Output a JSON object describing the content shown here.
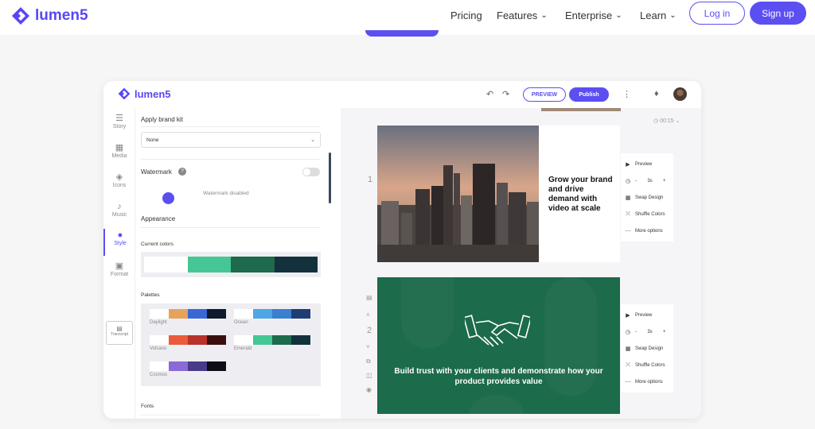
{
  "site": {
    "brand": "lumen5",
    "nav": [
      "Pricing",
      "Features",
      "Enterprise",
      "Learn"
    ],
    "login": "Log in",
    "signup": "Sign up",
    "brand_color": "#5b4ff2"
  },
  "app": {
    "brand": "lumen5",
    "preview": "PREVIEW",
    "publish": "Publish",
    "rail": [
      {
        "label": "Story",
        "icon": "story-icon"
      },
      {
        "label": "Media",
        "icon": "image-icon"
      },
      {
        "label": "Icons",
        "icon": "shapes-icon"
      },
      {
        "label": "Music",
        "icon": "music-icon"
      },
      {
        "label": "Style",
        "icon": "palette-icon"
      },
      {
        "label": "Format",
        "icon": "format-icon"
      },
      {
        "label": "Transcript",
        "icon": "transcript-icon"
      }
    ],
    "panel": {
      "brand_kit_label": "Apply brand kit",
      "brand_kit_value": "None",
      "watermark_label": "Watermark",
      "watermark_status": "Watermark disabled",
      "appearance": "Appearance",
      "current_colors_label": "Current colors",
      "current_colors": [
        "#ffffff",
        "#45c795",
        "#1d6a4d",
        "#13313d"
      ],
      "palettes_label": "Palettes",
      "palettes": [
        {
          "name": "Daylight",
          "colors": [
            "#ffffff",
            "#e8a35b",
            "#3a67d6",
            "#0d1a2f"
          ]
        },
        {
          "name": "Ocean",
          "colors": [
            "#ffffff",
            "#4fa6e3",
            "#3b7fd1",
            "#1e3d73"
          ]
        },
        {
          "name": "Volcano",
          "colors": [
            "#ffffff",
            "#ea5a3c",
            "#b8312a",
            "#3b0f0f"
          ]
        },
        {
          "name": "Emerald",
          "colors": [
            "#ffffff",
            "#45c795",
            "#1d6a4d",
            "#13313d"
          ]
        },
        {
          "name": "Cosmos",
          "colors": [
            "#ffffff",
            "#8a6ad6",
            "#4a3a8a",
            "#0d0d16"
          ]
        }
      ],
      "fonts_label": "Fonts"
    },
    "canvas": {
      "time": "00:15",
      "scene1_num": "1",
      "scene2_num": "2",
      "scene1_text": "Grow your brand and drive demand with video at scale",
      "scene2_text": "Build trust with your clients and demonstrate how your product provides value",
      "menu": {
        "preview": "Preview",
        "duration": "3s",
        "minus": "-",
        "plus": "+",
        "swap": "Swap Design",
        "shuffle": "Shuffle Colors",
        "more": "More options"
      }
    }
  }
}
